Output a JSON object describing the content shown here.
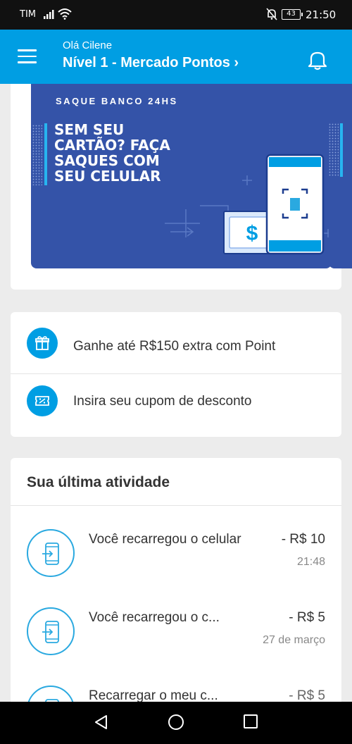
{
  "status_bar": {
    "carrier": "TIM",
    "battery": "43",
    "time": "21:50"
  },
  "header": {
    "greeting": "Olá Cilene",
    "level": "Nível 1 - Mercado Pontos ›"
  },
  "banner": {
    "kicker": "SAQUE BANCO 24HS",
    "headline": "SEM SEU\nCARTÃO? FAÇA\nSAQUES COM\nSEU CELULAR",
    "bill_symbol": "$"
  },
  "actions": [
    {
      "label": "Ganhe até R$150 extra com Point",
      "icon": "gift-icon"
    },
    {
      "label": "Insira seu cupom de desconto",
      "icon": "coupon-icon"
    }
  ],
  "activity": {
    "title": "Sua última atividade",
    "items": [
      {
        "description": "Você recarregou o celular",
        "amount": "- R$ 10",
        "when": "21:48",
        "icon": "phone-recharge-icon"
      },
      {
        "description": "Você recarregou o c...",
        "amount": "- R$ 5",
        "when": "27 de março",
        "icon": "phone-recharge-icon"
      },
      {
        "description": "Recarregar o meu c...",
        "amount": "- R$ 5",
        "when": "",
        "icon": "phone-recharge-icon"
      }
    ]
  },
  "colors": {
    "brand_blue": "#009ee3",
    "banner_blue": "#3453a8",
    "accent_cyan": "#27b5f0"
  }
}
